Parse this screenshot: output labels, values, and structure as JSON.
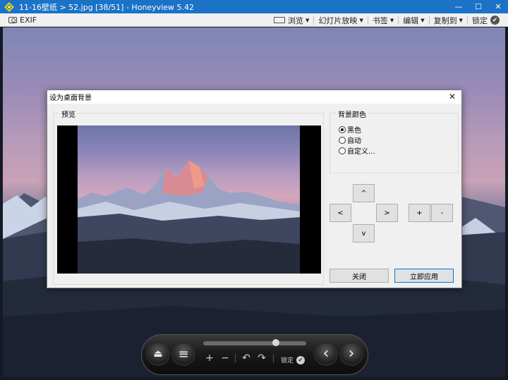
{
  "window": {
    "title": "11-16壁纸 > 52.jpg [38/51] - Honeyview 5.42",
    "minimize": "—",
    "maximize": "☐",
    "close": "✕"
  },
  "toolbar": {
    "exif_label": "EXIF",
    "browse_label": "浏览",
    "slideshow_label": "幻灯片放映",
    "bookmark_label": "书签",
    "edit_label": "编辑",
    "copy_to_label": "复制到",
    "lock_label": "锁定",
    "caret": "▼",
    "check": "✔"
  },
  "dialog": {
    "title": "设为桌面背景",
    "close": "✕",
    "preview_label": "预览",
    "bgcolor_label": "背景颜色",
    "options": [
      {
        "label": "黑色",
        "checked": true
      },
      {
        "label": "自动",
        "checked": false
      },
      {
        "label": "自定义...",
        "checked": false
      }
    ],
    "nav": {
      "up": "^",
      "left": "<",
      "right": ">",
      "down": "v"
    },
    "zoom_in": "+",
    "zoom_out": "-",
    "close_button": "关闭",
    "apply_button": "立即应用"
  },
  "osd": {
    "eject_icon": "⏏",
    "menu_icon": "≡",
    "zoom_in": "+",
    "zoom_out": "−",
    "rotate_left": "↶",
    "rotate_right": "↷",
    "lock_label": "锁定",
    "lock_check": "✔",
    "prev": "‹",
    "next": "›",
    "slider_position": 0.72
  }
}
